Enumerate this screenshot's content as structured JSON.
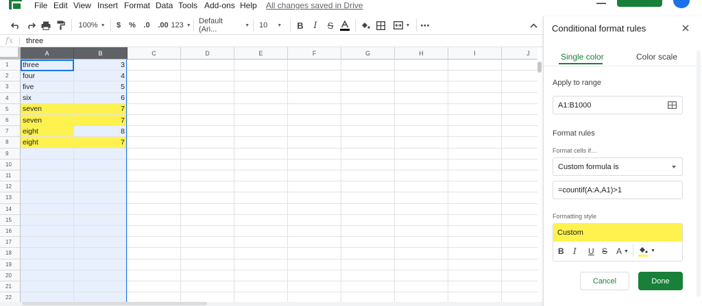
{
  "menu": {
    "items": [
      "File",
      "Edit",
      "View",
      "Insert",
      "Format",
      "Data",
      "Tools",
      "Add-ons",
      "Help"
    ],
    "saved_status": "All changes saved in Drive"
  },
  "toolbar": {
    "zoom": "100%",
    "currency": "$",
    "percent": "%",
    "decrease_decimal": ".0",
    "increase_decimal": ".00",
    "more_formats": "123",
    "font": "Default (Ari...",
    "font_size": "10",
    "more": "⋯",
    "collapse": "^"
  },
  "formula_bar": {
    "fx": "fx",
    "value": "three"
  },
  "grid": {
    "columns": [
      "A",
      "B",
      "C",
      "D",
      "E",
      "F",
      "G",
      "H",
      "I",
      "J"
    ],
    "rows": [
      {
        "n": "1",
        "a": "three",
        "b": "3",
        "hl_a": false,
        "hl_b": false
      },
      {
        "n": "2",
        "a": "four",
        "b": "4",
        "hl_a": false,
        "hl_b": false
      },
      {
        "n": "3",
        "a": "five",
        "b": "5",
        "hl_a": false,
        "hl_b": false
      },
      {
        "n": "4",
        "a": "six",
        "b": "6",
        "hl_a": false,
        "hl_b": false
      },
      {
        "n": "5",
        "a": "seven",
        "b": "7",
        "hl_a": true,
        "hl_b": true
      },
      {
        "n": "6",
        "a": "seven",
        "b": "7",
        "hl_a": true,
        "hl_b": true
      },
      {
        "n": "7",
        "a": "eight",
        "b": "8",
        "hl_a": true,
        "hl_b": false
      },
      {
        "n": "8",
        "a": "eight",
        "b": "7",
        "hl_a": true,
        "hl_b": true
      },
      {
        "n": "9",
        "a": "",
        "b": "",
        "hl_a": false,
        "hl_b": false
      },
      {
        "n": "10",
        "a": "",
        "b": "",
        "hl_a": false,
        "hl_b": false
      },
      {
        "n": "11",
        "a": "",
        "b": "",
        "hl_a": false,
        "hl_b": false
      },
      {
        "n": "12",
        "a": "",
        "b": "",
        "hl_a": false,
        "hl_b": false
      },
      {
        "n": "13",
        "a": "",
        "b": "",
        "hl_a": false,
        "hl_b": false
      },
      {
        "n": "14",
        "a": "",
        "b": "",
        "hl_a": false,
        "hl_b": false
      },
      {
        "n": "15",
        "a": "",
        "b": "",
        "hl_a": false,
        "hl_b": false
      },
      {
        "n": "16",
        "a": "",
        "b": "",
        "hl_a": false,
        "hl_b": false
      },
      {
        "n": "17",
        "a": "",
        "b": "",
        "hl_a": false,
        "hl_b": false
      },
      {
        "n": "18",
        "a": "",
        "b": "",
        "hl_a": false,
        "hl_b": false
      },
      {
        "n": "19",
        "a": "",
        "b": "",
        "hl_a": false,
        "hl_b": false
      },
      {
        "n": "20",
        "a": "",
        "b": "",
        "hl_a": false,
        "hl_b": false
      },
      {
        "n": "21",
        "a": "",
        "b": "",
        "hl_a": false,
        "hl_b": false
      },
      {
        "n": "22",
        "a": "",
        "b": "",
        "hl_a": false,
        "hl_b": false
      }
    ],
    "highlight_color": "#fff24f",
    "selection_color": "#e8f0fe"
  },
  "panel": {
    "title": "Conditional format rules",
    "tabs": [
      "Single color",
      "Color scale"
    ],
    "apply_to_range_label": "Apply to range",
    "range_value": "A1:B1000",
    "format_rules_label": "Format rules",
    "format_cells_if_label": "Format cells if…",
    "condition": "Custom formula is",
    "formula": "=countif(A:A,A1)>1",
    "formatting_style_label": "Formatting style",
    "style_preview": "Custom",
    "style_buttons": [
      "B",
      "I",
      "U",
      "S",
      "A"
    ],
    "cancel_label": "Cancel",
    "done_label": "Done",
    "accent_color": "#188038"
  }
}
